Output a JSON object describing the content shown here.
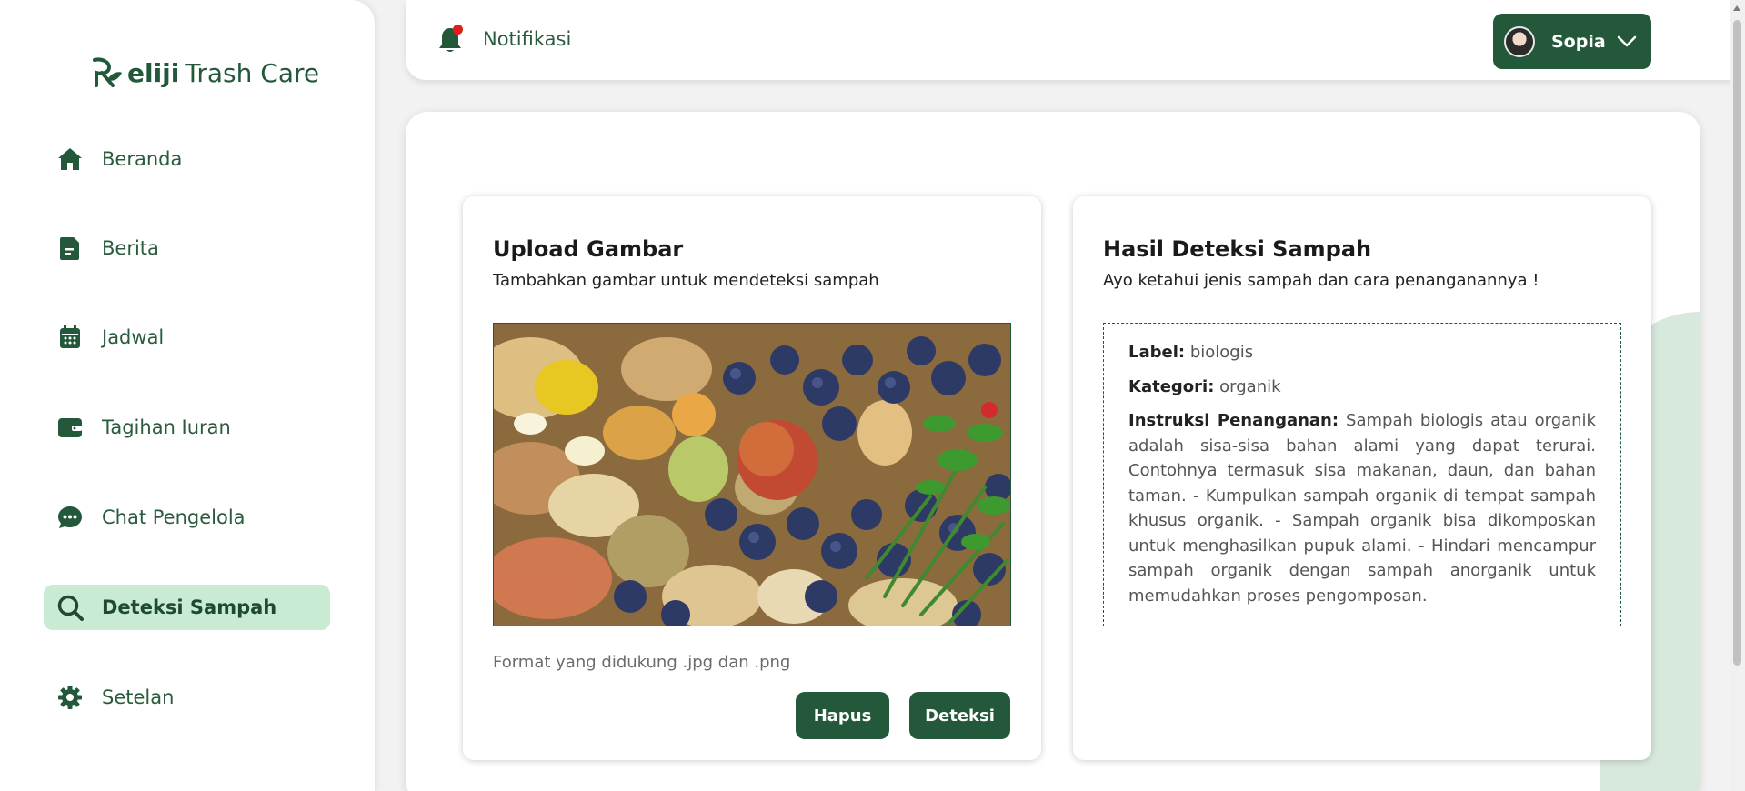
{
  "brand": {
    "strong": "eliji",
    "rest": "Trash Care"
  },
  "sidebar": {
    "items": [
      {
        "label": "Beranda",
        "icon": "home-icon"
      },
      {
        "label": "Berita",
        "icon": "document-icon"
      },
      {
        "label": "Jadwal",
        "icon": "calendar-icon"
      },
      {
        "label": "Tagihan Iuran",
        "icon": "wallet-icon"
      },
      {
        "label": "Chat Pengelola",
        "icon": "chat-icon"
      },
      {
        "label": "Deteksi Sampah",
        "icon": "search-icon",
        "active": true
      },
      {
        "label": "Setelan",
        "icon": "gear-icon"
      }
    ]
  },
  "topbar": {
    "notification_label": "Notifikasi",
    "user_name": "Sopia"
  },
  "upload": {
    "title": "Upload Gambar",
    "subtitle": "Tambahkan gambar untuk mendeteksi sampah",
    "format_note": "Format yang didukung .jpg dan .png",
    "delete_label": "Hapus",
    "detect_label": "Deteksi"
  },
  "result": {
    "title": "Hasil Deteksi Sampah",
    "subtitle": "Ayo ketahui jenis sampah dan cara penanganannya !",
    "label_key": "Label:",
    "label_value": "biologis",
    "category_key": "Kategori:",
    "category_value": "organik",
    "instruction_key": "Instruksi Penanganan:",
    "instruction_value": "Sampah biologis atau organik adalah sisa-sisa bahan alami yang dapat terurai. Contohnya termasuk sisa makanan, daun, dan bahan taman. - Kumpulkan sampah organik di tempat sampah khusus organik. - Sampah organik bisa dikomposkan untuk menghasilkan pupuk alami. - Hindari mencampur sampah organik dengan sampah anorganik untuk memudahkan proses pengomposan."
  },
  "colors": {
    "primary": "#23583a",
    "active_bg": "#c8ebd4",
    "notification_dot": "#e11d1d"
  }
}
